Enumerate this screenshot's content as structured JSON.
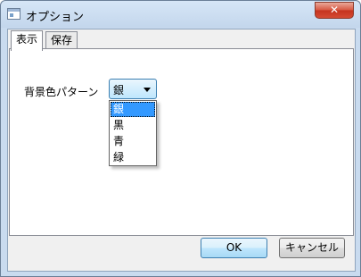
{
  "window": {
    "title": "オプション",
    "close_label": "✕"
  },
  "tabs": [
    {
      "label": "表示",
      "active": true
    },
    {
      "label": "保存",
      "active": false
    }
  ],
  "display_tab": {
    "background_label": "背景色パターン",
    "background_value": "銀",
    "options": [
      "銀",
      "黒",
      "青",
      "緑"
    ],
    "selected_index": 0
  },
  "buttons": {
    "ok_label": "OK",
    "cancel_label": "キャンセル"
  }
}
